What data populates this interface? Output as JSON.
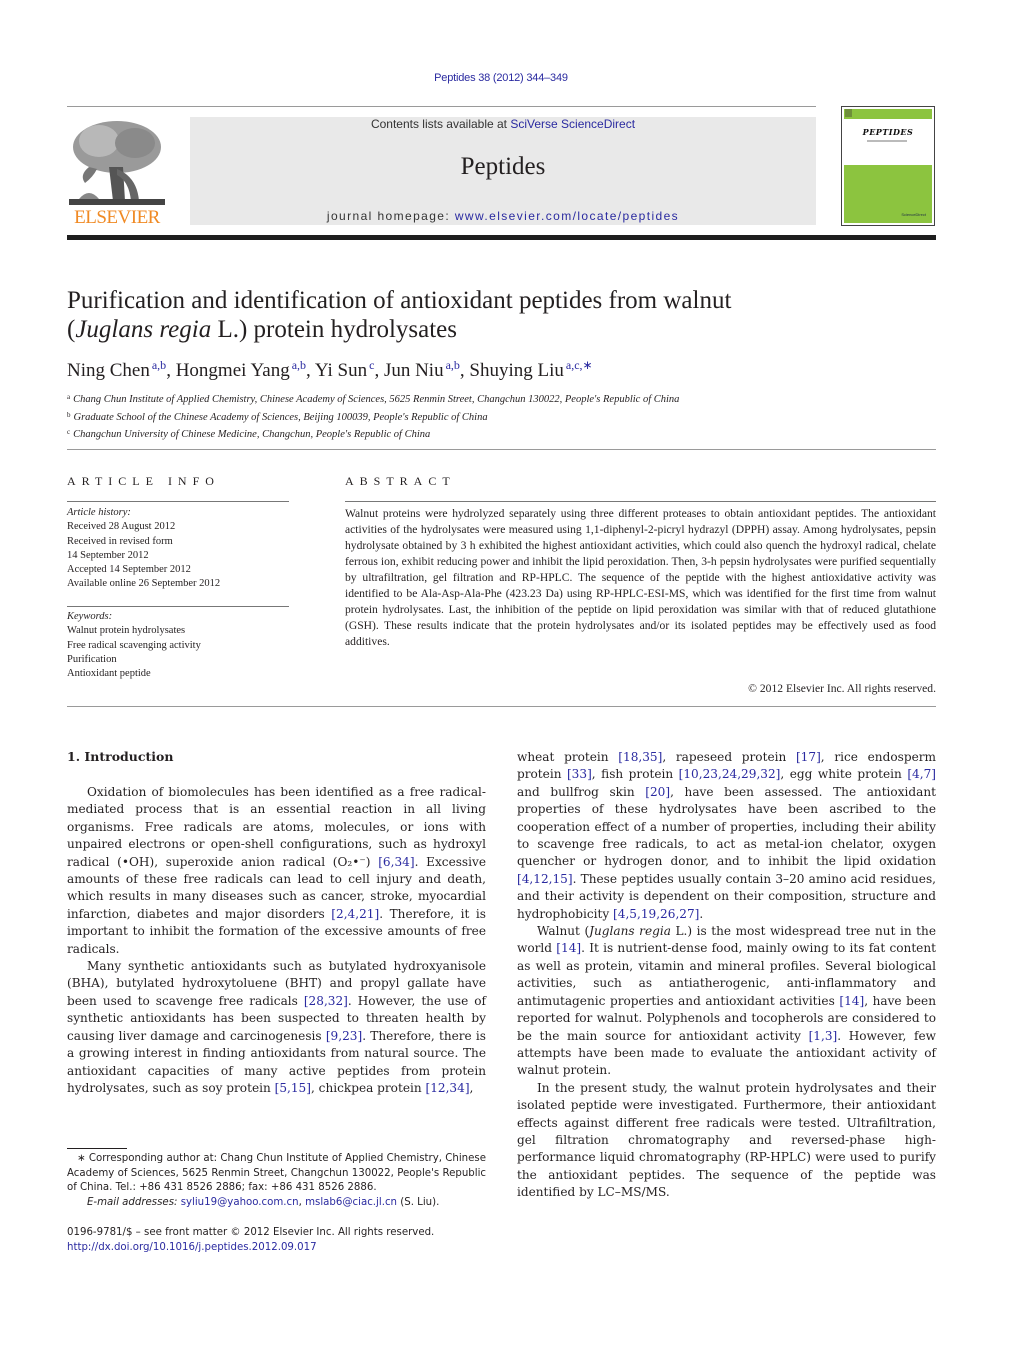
{
  "header": {
    "journal_ref": "Peptides 38 (2012) 344–349",
    "contents_prefix": "Contents lists available at ",
    "contents_link": "SciVerse ScienceDirect",
    "journal_title": "Peptides",
    "homepage_prefix": "journal homepage: ",
    "homepage_link": "www.elsevier.com/locate/peptides",
    "publisher_wordmark": "ELSEVIER",
    "cover_title": "PEPTIDES",
    "cover_publisher": "ScienceDirect",
    "colors": {
      "elsevier_orange": "#f08a24",
      "link_blue": "#2a2aa0",
      "cover_green": "#8cc43f"
    }
  },
  "article": {
    "title_line1": "Purification and identification of antioxidant peptides from walnut",
    "title_line2_open": "(",
    "title_line2_italic": "Juglans regia",
    "title_line2_rest": " L.) protein hydrolysates",
    "authors": [
      {
        "name": "Ning Chen",
        "sup": "a,b"
      },
      {
        "name": "Hongmei Yang",
        "sup": "a,b"
      },
      {
        "name": "Yi Sun",
        "sup": "c"
      },
      {
        "name": "Jun Niu",
        "sup": "a,b"
      },
      {
        "name": "Shuying Liu",
        "sup": "a,c,∗"
      }
    ],
    "author_separator": ", ",
    "affiliations": [
      {
        "mark": "a",
        "text": "Chang Chun Institute of Applied Chemistry, Chinese Academy of Sciences, 5625 Renmin Street, Changchun 130022, People's Republic of China"
      },
      {
        "mark": "b",
        "text": "Graduate School of the Chinese Academy of Sciences, Beijing 100039, People's Republic of China"
      },
      {
        "mark": "c",
        "text": "Changchun University of Chinese Medicine, Changchun, People's Republic of China"
      }
    ]
  },
  "article_info": {
    "heading": "ARTICLE INFO",
    "history_label": "Article history:",
    "history": [
      "Received 28 August 2012",
      "Received in revised form",
      "14 September 2012",
      "Accepted 14 September 2012",
      "Available online 26 September 2012"
    ],
    "keywords_label": "Keywords:",
    "keywords": [
      "Walnut protein hydrolysates",
      "Free radical scavenging activity",
      "Purification",
      "Antioxidant peptide"
    ]
  },
  "abstract": {
    "heading": "ABSTRACT",
    "text": "Walnut proteins were hydrolyzed separately using three different proteases to obtain antioxidant peptides. The antioxidant activities of the hydrolysates were measured using 1,1-diphenyl-2-picryl hydrazyl (DPPH) assay. Among hydrolysates, pepsin hydrolysate obtained by 3 h exhibited the highest antioxidant activities, which could also quench the hydroxyl radical, chelate ferrous ion, exhibit reducing power and inhibit the lipid peroxidation. Then, 3-h pepsin hydrolysates were purified sequentially by ultrafiltration, gel filtration and RP-HPLC. The sequence of the peptide with the highest antioxidative activity was identified to be Ala-Asp-Ala-Phe (423.23 Da) using RP-HPLC-ESI-MS, which was identified for the first time from walnut protein hydrolysates. Last, the inhibition of the peptide on lipid peroxidation was similar with that of reduced glutathione (GSH). These results indicate that the protein hydrolysates and/or its isolated peptides may be effectively used as food additives.",
    "copyright": "© 2012 Elsevier Inc. All rights reserved."
  },
  "body": {
    "section_heading": "1.  Introduction",
    "left_paragraphs": [
      [
        {
          "t": "Oxidation of biomolecules has been identified as a free radical-mediated process that is an essential reaction in all living organisms. Free radicals are atoms, molecules, or ions with unpaired electrons or open-shell configurations, such as hydroxyl radical (•OH), superoxide anion radical (O₂•⁻) "
        },
        {
          "c": "[6,34]"
        },
        {
          "t": ". Excessive amounts of these free radicals can lead to cell injury and death, which results in many diseases such as cancer, stroke, myocardial infarction, diabetes and major disorders "
        },
        {
          "c": "[2,4,21]"
        },
        {
          "t": ". Therefore, it is important to inhibit the formation of the excessive amounts of free radicals."
        }
      ],
      [
        {
          "t": "Many synthetic antioxidants such as butylated hydroxyanisole (BHA), butylated hydroxytoluene (BHT) and propyl gallate have been used to scavenge free radicals "
        },
        {
          "c": "[28,32]"
        },
        {
          "t": ". However, the use of synthetic antioxidants has been suspected to threaten health by causing liver damage and carcinogenesis "
        },
        {
          "c": "[9,23]"
        },
        {
          "t": ". Therefore, there is a growing interest in finding antioxidants from natural source. The antioxidant capacities of many active peptides from protein hydrolysates, such as soy protein "
        },
        {
          "c": "[5,15]"
        },
        {
          "t": ", chickpea protein "
        },
        {
          "c": "[12,34]"
        },
        {
          "t": ","
        }
      ]
    ],
    "right_paragraphs": [
      [
        {
          "t": "wheat protein "
        },
        {
          "c": "[18,35]"
        },
        {
          "t": ", rapeseed protein "
        },
        {
          "c": "[17]"
        },
        {
          "t": ", rice endosperm protein "
        },
        {
          "c": "[33]"
        },
        {
          "t": ", fish protein "
        },
        {
          "c": "[10,23,24,29,32]"
        },
        {
          "t": ", egg white protein "
        },
        {
          "c": "[4,7]"
        },
        {
          "t": " and bullfrog skin "
        },
        {
          "c": "[20]"
        },
        {
          "t": ", have been assessed. The antioxidant properties of these hydrolysates have been ascribed to the cooperation effect of a number of properties, including their ability to scavenge free radicals, to act as metal-ion chelator, oxygen quencher or hydrogen donor, and to inhibit the lipid oxidation "
        },
        {
          "c": "[4,12,15]"
        },
        {
          "t": ". These peptides usually contain 3–20 amino acid residues, and their activity is dependent on their composition, structure and hydrophobicity "
        },
        {
          "c": "[4,5,19,26,27]"
        },
        {
          "t": "."
        }
      ],
      [
        {
          "t": "Walnut ("
        },
        {
          "i": "Juglans regia"
        },
        {
          "t": " L.) is the most widespread tree nut in the world "
        },
        {
          "c": "[14]"
        },
        {
          "t": ". It is nutrient-dense food, mainly owing to its fat content as well as protein, vitamin and mineral profiles. Several biological activities, such as antiatherogenic, anti-inflammatory and antimutagenic properties and antioxidant activities "
        },
        {
          "c": "[14]"
        },
        {
          "t": ", have been reported for walnut. Polyphenols and tocopherols are considered to be the main source for antioxidant activity "
        },
        {
          "c": "[1,3]"
        },
        {
          "t": ". However, few attempts have been made to evaluate the antioxidant activity of walnut protein."
        }
      ],
      [
        {
          "t": "In the present study, the walnut protein hydrolysates and their isolated peptide were investigated. Furthermore, their antioxidant effects against different free radicals were tested. Ultrafiltration, gel filtration chromatography and reversed-phase high-performance liquid chromatography (RP-HPLC) were used to purify the antioxidant peptides. The sequence of the peptide was identified by LC–MS/MS."
        }
      ]
    ]
  },
  "footnote": {
    "star": "∗",
    "corresponding": "Corresponding author at: Chang Chun Institute of Applied Chemistry, Chinese Academy of Sciences, 5625 Renmin Street, Changchun 130022, People's Republic of China. Tel.: +86 431 8526 2886; fax: +86 431 8526 2886.",
    "email_label": "E-mail addresses:",
    "email1": "syliu19@yahoo.com.cn",
    "email_sep": ", ",
    "email2": "mslab6@ciac.jl.cn",
    "email_suffix": " (S. Liu).",
    "front_matter": "0196-9781/$ – see front matter © 2012 Elsevier Inc. All rights reserved.",
    "doi": "http://dx.doi.org/10.1016/j.peptides.2012.09.017"
  }
}
